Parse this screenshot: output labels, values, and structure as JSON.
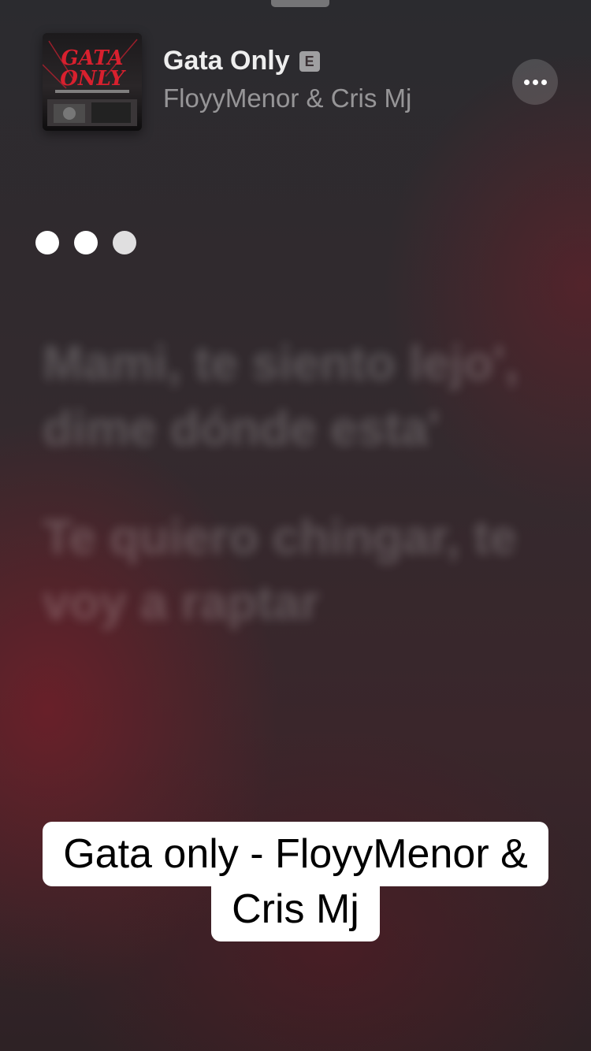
{
  "now_playing": {
    "title": "Gata Only",
    "explicit_badge": "E",
    "artist": "FloyyMenor & Cris Mj",
    "artwork_icon": "album-artwork",
    "artwork_text": "GATA ONLY",
    "more_icon": "ellipsis-icon"
  },
  "lyrics": {
    "lines": [
      "Mami, te siento lejo', dime dónde esta'",
      "Te quiero chingar, te voy a raptar"
    ]
  },
  "caption": {
    "text": "Gata only - FloyyMenor & Cris Mj"
  },
  "colors": {
    "accent": "#7a1e28",
    "caption_bg": "#ffffff"
  }
}
